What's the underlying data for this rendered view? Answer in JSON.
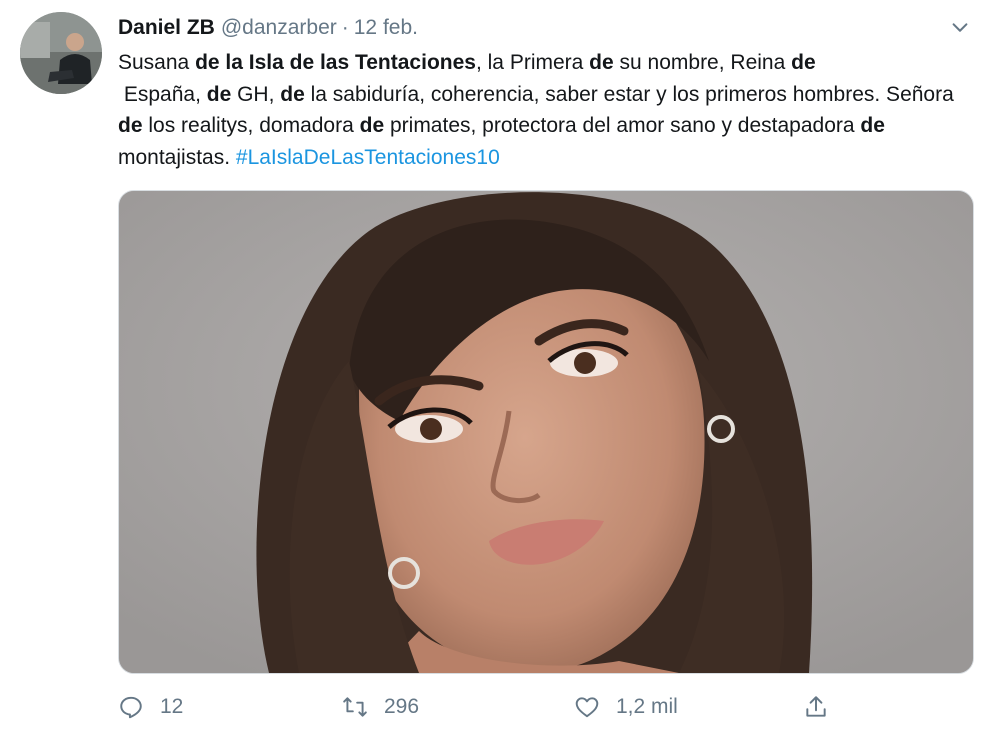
{
  "tweet": {
    "display_name": "Daniel ZB",
    "handle": "@danzarber",
    "separator": "·",
    "date": "12 feb.",
    "text_segments": [
      {
        "t": "Susana ",
        "b": false
      },
      {
        "t": "de la Isla de las Tentaciones",
        "b": true
      },
      {
        "t": ", la Primera ",
        "b": false
      },
      {
        "t": "de",
        "b": true
      },
      {
        "t": " su nombre, Reina ",
        "b": false
      },
      {
        "t": "de",
        "b": true
      },
      {
        "t": "\n España, ",
        "b": false
      },
      {
        "t": "de",
        "b": true
      },
      {
        "t": " GH, ",
        "b": false
      },
      {
        "t": "de",
        "b": true
      },
      {
        "t": " la sabiduría, coherencia, saber estar y los primeros hombres. Señora ",
        "b": false
      },
      {
        "t": "de",
        "b": true
      },
      {
        "t": " los realitys, domadora ",
        "b": false
      },
      {
        "t": "de",
        "b": true
      },
      {
        "t": " primates, protectora del amor sano y destapadora ",
        "b": false
      },
      {
        "t": "de",
        "b": true
      },
      {
        "t": " montajistas. ",
        "b": false
      }
    ],
    "hashtag": "#LaIslaDeLasTentaciones10",
    "actions": {
      "reply_icon": "reply-icon",
      "reply_count": "12",
      "retweet_icon": "retweet-icon",
      "retweet_count": "296",
      "like_icon": "heart-icon",
      "like_count": "1,2 mil",
      "share_icon": "share-icon"
    },
    "colors": {
      "text": "#14171a",
      "muted": "#657786",
      "link": "#1b95e0"
    }
  }
}
